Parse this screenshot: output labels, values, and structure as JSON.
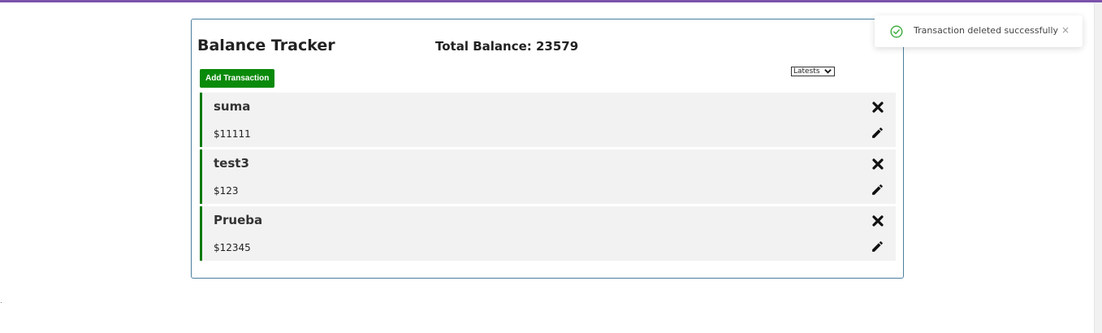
{
  "header": {
    "title": "Balance Tracker",
    "total_balance": "Total Balance: 23579"
  },
  "toolbar": {
    "add_label": "Add Transaction",
    "sort_selected": "Latests"
  },
  "transactions": [
    {
      "name": "suma",
      "amount": "$11111"
    },
    {
      "name": "test3",
      "amount": "$123"
    },
    {
      "name": "Prueba",
      "amount": "$12345"
    }
  ],
  "toast": {
    "message": "Transaction deleted successfully",
    "close_symbol": "×"
  },
  "colors": {
    "accent_green": "#0a8a0a",
    "top_bar": "#7b52ab",
    "container_border": "#4a7fa0",
    "item_background": "#f2f2f2"
  },
  "icons": [
    "check-circle-icon",
    "close-icon",
    "delete-icon",
    "edit-icon",
    "chevron-down-icon"
  ]
}
